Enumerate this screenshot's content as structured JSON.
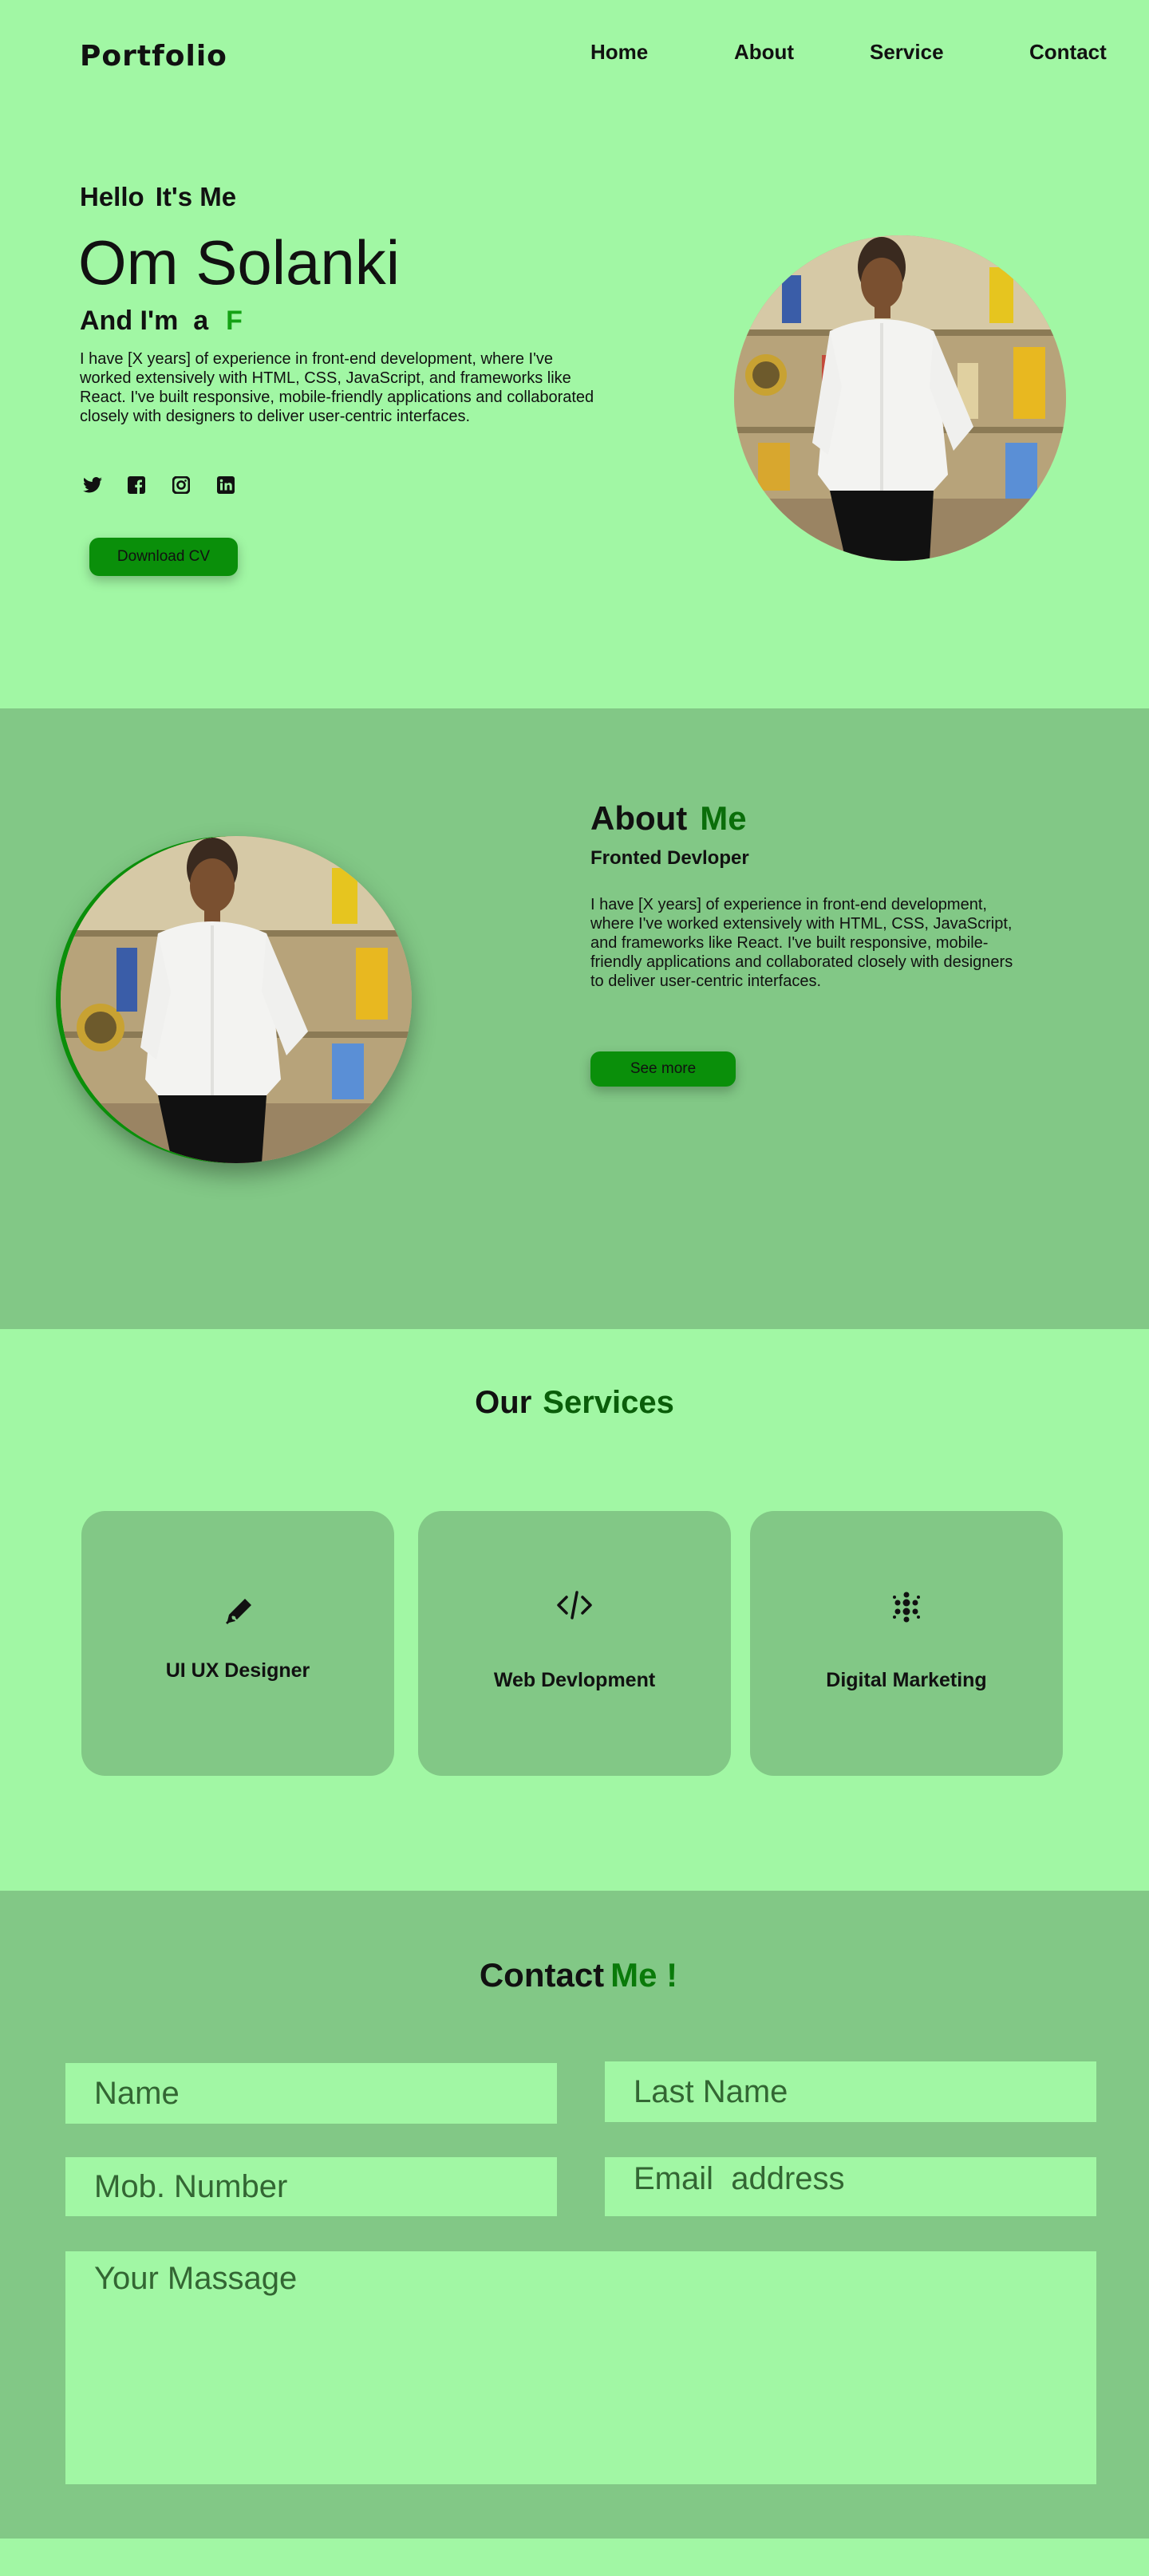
{
  "nav": {
    "logo": "Portfolio",
    "links": [
      "Home",
      "About",
      "Service",
      "Contact"
    ]
  },
  "hero": {
    "hello": "Hello",
    "its_me": "It's Me",
    "name": "Om Solanki",
    "role_prefix": "And I'm  a",
    "role_typed": "F",
    "intro": "I have [X years] of experience in front-end development, where I've worked extensively with HTML, CSS, JavaScript, and frameworks like React. I've built responsive, mobile-friendly applications and collaborated closely with designers to deliver user-centric interfaces.",
    "socials": [
      "twitter-icon",
      "facebook-icon",
      "instagram-icon",
      "linkedin-icon"
    ],
    "download_label": "Download CV"
  },
  "about": {
    "title": "About",
    "title_highlight": "Me",
    "subtitle": "Fronted Devloper",
    "text": "I have [X years] of experience in front-end development, where I've worked extensively with HTML, CSS, JavaScript, and frameworks like React. I've built responsive, mobile-friendly applications and collaborated closely with designers to deliver user-centric interfaces.",
    "see_more_label": "See more"
  },
  "services": {
    "title": "Our",
    "title_highlight": "Services",
    "items": [
      {
        "icon": "pen-icon",
        "label": "UI UX Designer"
      },
      {
        "icon": "code-icon",
        "label": "Web Devlopment"
      },
      {
        "icon": "dots-grid-icon",
        "label": "Digital Marketing"
      }
    ]
  },
  "contact": {
    "title": "Contact",
    "title_highlight": "Me !",
    "fields": {
      "name": "Name",
      "last_name": "Last Name",
      "mobile": "Mob. Number",
      "email": "Email  address",
      "message": "Your Massage"
    }
  },
  "colors": {
    "page_bg": "#a1f7a4",
    "section_bg": "#82c886",
    "accent": "#0a8f0a",
    "highlight_text": "#14a214"
  }
}
